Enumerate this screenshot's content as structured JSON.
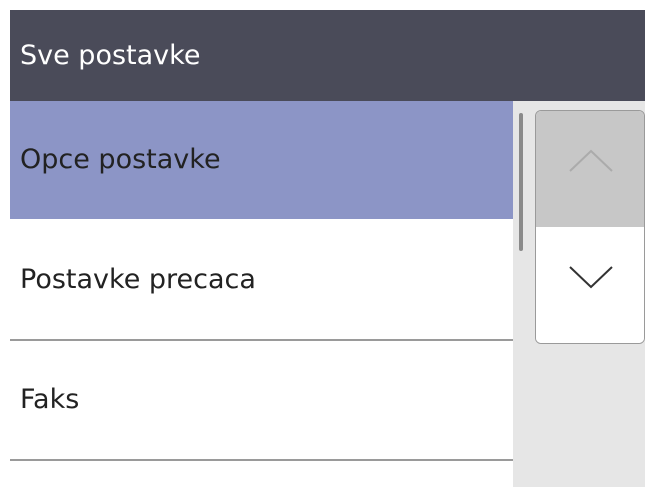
{
  "header": {
    "title": "Sve postavke"
  },
  "menu": {
    "items": [
      {
        "label": "Opce postavke",
        "selected": true
      },
      {
        "label": "Postavke precaca",
        "selected": false
      },
      {
        "label": "Faks",
        "selected": false
      }
    ]
  },
  "scroll": {
    "up_icon": "chevron-up-icon",
    "down_icon": "chevron-down-icon"
  },
  "colors": {
    "header_bg": "#4a4b59",
    "selected_bg": "#8c95c6",
    "side_bg": "#e6e6e6"
  }
}
